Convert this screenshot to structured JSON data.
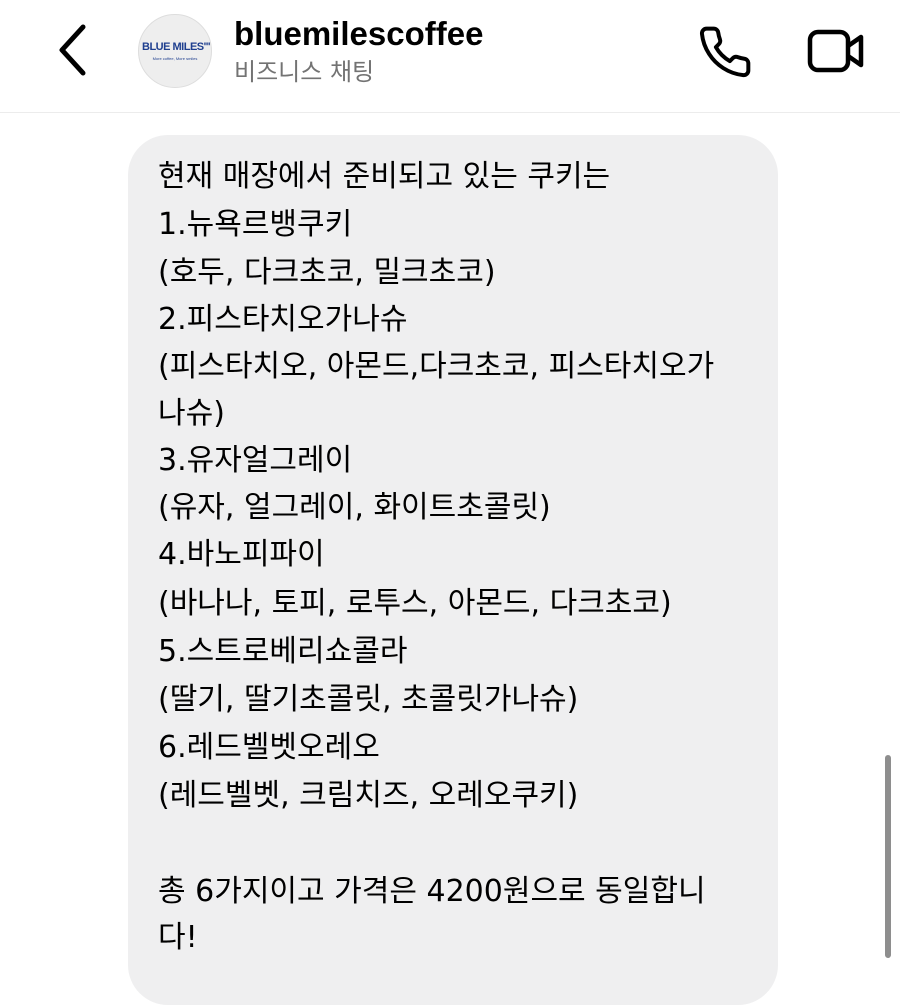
{
  "header": {
    "account_name": "bluemilescoffee",
    "account_subtitle": "비즈니스 채팅",
    "avatar_logo_text": "BLUE MILES''''",
    "avatar_tagline": "More coffee, More smiles"
  },
  "icons": {
    "back": "chevron-left-icon",
    "call": "phone-icon",
    "video": "video-camera-icon"
  },
  "message": {
    "lines": [
      "현재 매장에서 준비되고 있는 쿠키는",
      "1.뉴욕르뱅쿠키",
      "(호두, 다크초코, 밀크초코)",
      "2.피스타치오가나슈",
      "(피스타치오, 아몬드,다크초코, 피스타치오가",
      "나슈)",
      "3.유자얼그레이",
      "(유자, 얼그레이, 화이트초콜릿)",
      "4.바노피파이",
      "(바나나, 토피, 로투스, 아몬드, 다크초코)",
      "5.스트로베리쇼콜라",
      "(딸기, 딸기초콜릿, 초콜릿가나슈)",
      "6.레드벨벳오레오",
      "(레드벨벳, 크림치즈, 오레오쿠키)",
      "",
      "총 6가지이고 가격은 4200원으로 동일합니",
      "다!"
    ]
  },
  "colors": {
    "bubble_background": "#efeff0",
    "subtitle_text": "#737373",
    "logo_blue": "#1f3f8f"
  }
}
